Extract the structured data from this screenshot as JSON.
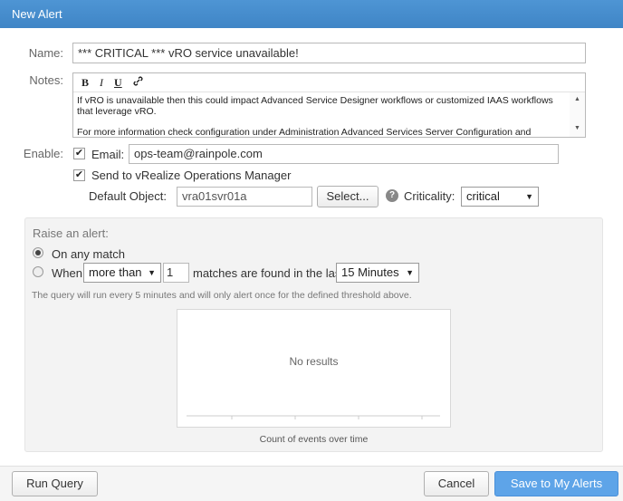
{
  "dialog": {
    "title": "New Alert"
  },
  "form": {
    "name_label": "Name:",
    "name_value": "*** CRITICAL *** vRO service unavailable!",
    "notes_label": "Notes:",
    "notes_toolbar": {
      "bold": "B",
      "italic": "I",
      "underline": "U",
      "link_icon": "link-icon"
    },
    "notes_text": "If vRO is unavailable then this could impact Advanced Service Designer workflows or customized IAAS workflows that leverage vRO.",
    "notes_text_2": "For more information check configuration under Administration Advanced Services Server Configuration and",
    "enable_label": "Enable:",
    "email_label": "Email:",
    "email_checked": true,
    "email_value": "ops-team@rainpole.com",
    "vrops_checked": true,
    "vrops_label": "Send to vRealize Operations Manager",
    "default_object_label": "Default Object:",
    "default_object_value": "vra01svr01a",
    "select_button": "Select...",
    "criticality_label": "Criticality:",
    "criticality_value": "critical"
  },
  "raise": {
    "heading": "Raise an alert:",
    "option_any": "On any match",
    "option_when": "When",
    "selected": "any",
    "comparator": "more than",
    "count": "1",
    "matches_text": "matches are found in the last",
    "period": "15 Minutes",
    "info": "The query will run every 5 minutes and will only alert once for the defined threshold above."
  },
  "chart": {
    "empty_text": "No results",
    "caption": "Count of events over time"
  },
  "chart_data": {
    "type": "bar",
    "title": "",
    "xlabel": "Count of events over time",
    "ylabel": "",
    "categories": [],
    "values": [],
    "empty_message": "No results"
  },
  "footer": {
    "run_query": "Run Query",
    "cancel": "Cancel",
    "save": "Save to My Alerts"
  },
  "colors": {
    "titlebar": "#4a90d0",
    "primary_button": "#5ea4e8"
  }
}
